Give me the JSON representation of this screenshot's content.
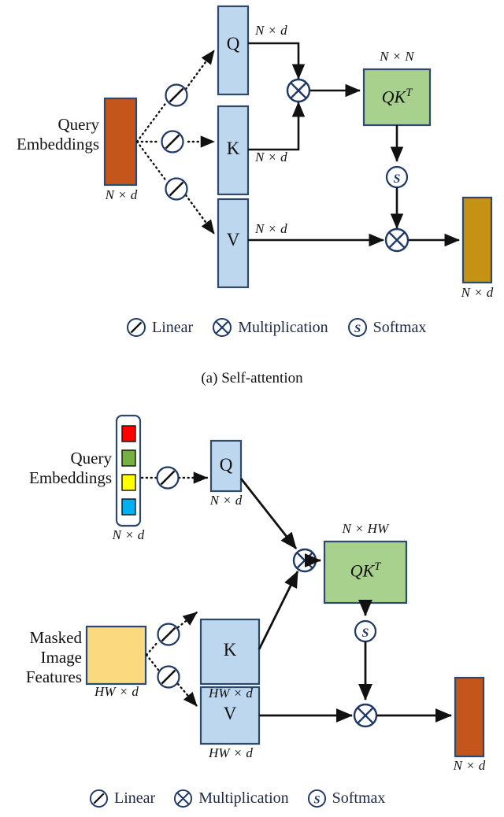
{
  "figure": {
    "title": "Attention mechanism diagrams",
    "colors": {
      "query_embedding_box": "#c4561b",
      "qkv_box": "#bdd7ee",
      "qkv_border": "#2e4a6b",
      "qkt_box": "#a9d18e",
      "qkt_border": "#2e4a6b",
      "output_top": "#c69214",
      "output_bottom": "#c4561b",
      "masked_features": "#fad97f",
      "stroke": "#111111",
      "icon_stroke": "#1f3864",
      "swatch_red": "#ff0000",
      "swatch_green": "#76b043",
      "swatch_yellow": "#ffff00",
      "swatch_blue": "#00b0f0"
    }
  },
  "panel_a": {
    "caption": "(a) Self-attention",
    "input_label_line1": "Query",
    "input_label_line2": "Embeddings",
    "input_dim": "N × d",
    "branches": [
      {
        "letter": "Q",
        "dim": "N × d"
      },
      {
        "letter": "K",
        "dim": "N × d"
      },
      {
        "letter": "V",
        "dim": "N × d"
      }
    ],
    "matmul_box": {
      "label": "QK",
      "superscript": "T",
      "dim": "N × N"
    },
    "output_dim": "N × d",
    "linear_icon": "linear-icon",
    "multiply_icon": "multiplication-icon",
    "softmax_icon": "softmax-icon"
  },
  "panel_b": {
    "caption": "",
    "query_label_line1": "Query",
    "query_label_line2": "Embeddings",
    "query_dim": "N × d",
    "query_swatches": [
      "red",
      "green",
      "yellow",
      "blue"
    ],
    "masked_label_line1": "Masked",
    "masked_label_line2": "Image",
    "masked_label_line3": "Features",
    "masked_dim": "HW × d",
    "branches": [
      {
        "letter": "Q",
        "dim": "N × d"
      },
      {
        "letter": "K",
        "dim": "HW × d"
      },
      {
        "letter": "V",
        "dim": "HW × d"
      }
    ],
    "matmul_box": {
      "label": "QK",
      "superscript": "T",
      "dim": "N × HW"
    },
    "output_dim": "N × d"
  },
  "legend": {
    "items": [
      {
        "icon": "linear-icon",
        "label": "Linear"
      },
      {
        "icon": "multiplication-icon",
        "label": "Multiplication"
      },
      {
        "icon": "softmax-icon",
        "label": "Softmax"
      }
    ]
  }
}
